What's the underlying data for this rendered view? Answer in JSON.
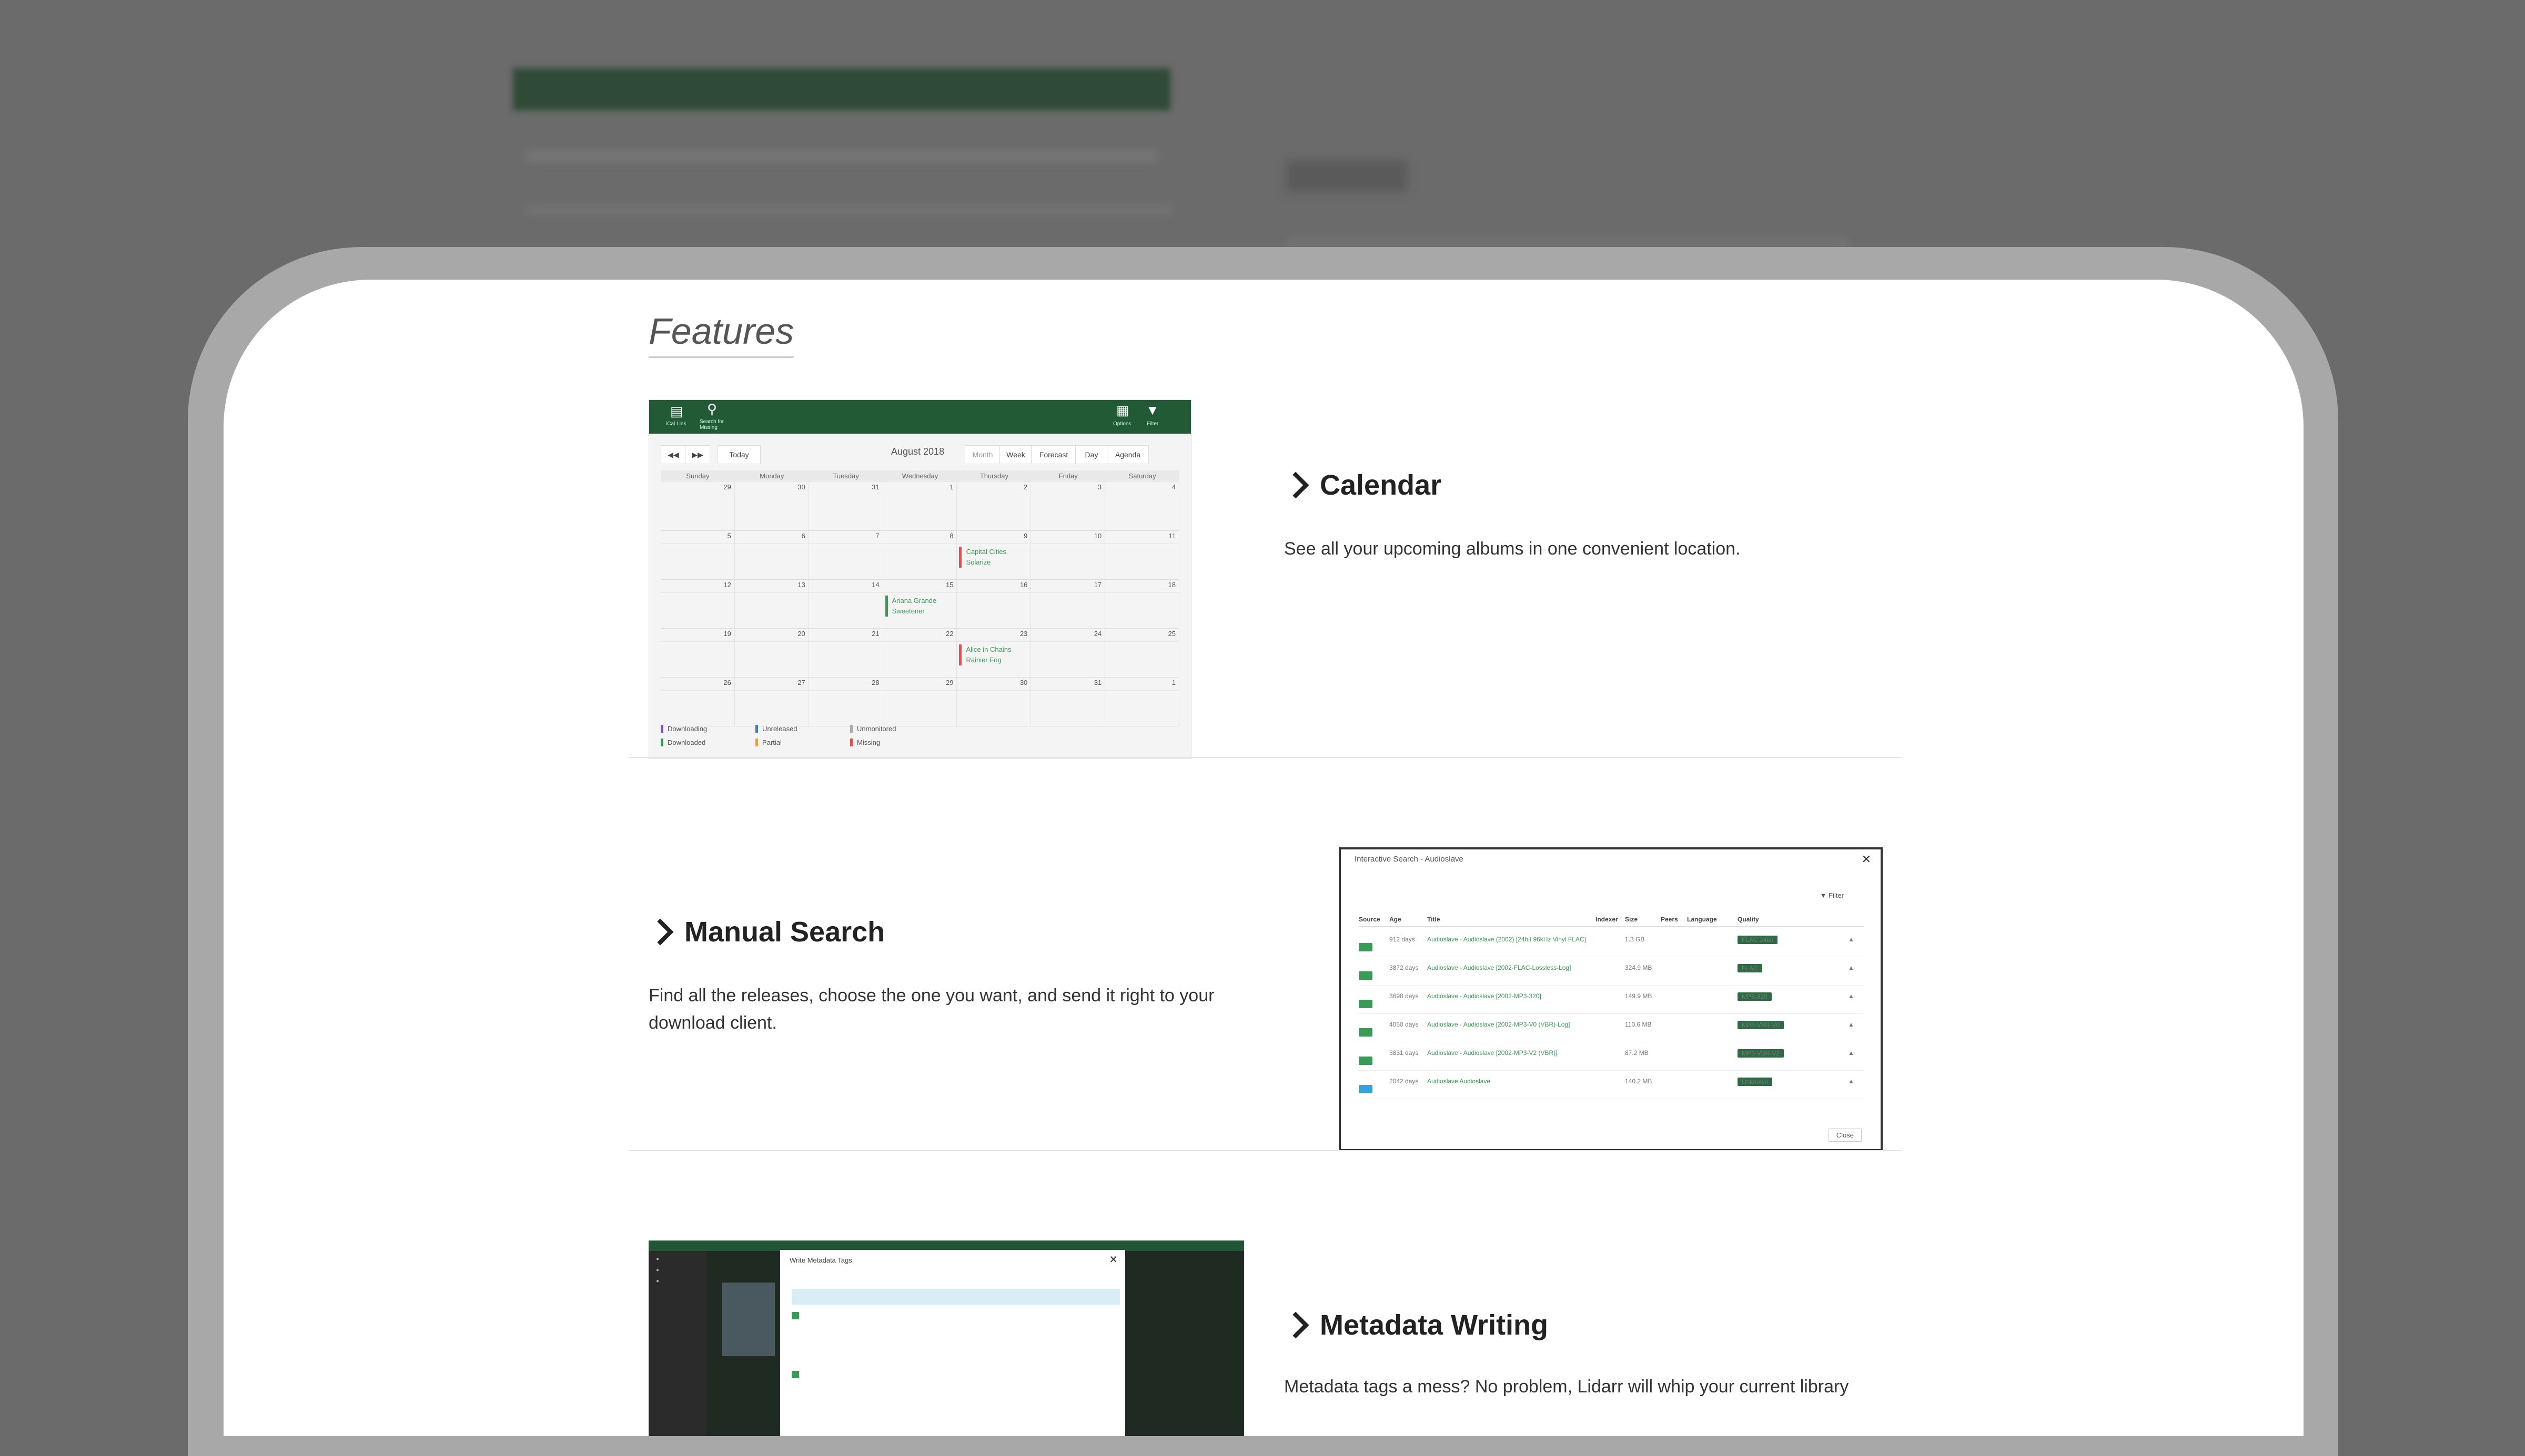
{
  "page": {
    "section_title": "Features"
  },
  "features": [
    {
      "heading": "Calendar",
      "description": "See all your upcoming albums in one convenient location."
    },
    {
      "heading": "Manual Search",
      "description": "Find all the releases, choose the one you want, and send it right to your download client."
    },
    {
      "heading": "Metadata Writing",
      "description": "Metadata tags a mess? No problem, Lidarr will whip your current library"
    }
  ],
  "calendar_screenshot": {
    "toolbar": [
      "iCal Link",
      "Search for Missing",
      "Options",
      "Filter"
    ],
    "nav": [
      "Today"
    ],
    "month": "August 2018",
    "views": [
      "Month",
      "Week",
      "Forecast",
      "Day",
      "Agenda"
    ],
    "days_of_week": [
      "Sunday",
      "Monday",
      "Tuesday",
      "Wednesday",
      "Thursday",
      "Friday",
      "Saturday"
    ],
    "weeks": [
      [
        "29",
        "30",
        "31",
        "1",
        "2",
        "3",
        "4"
      ],
      [
        "5",
        "6",
        "7",
        "8",
        "9",
        "10",
        "11"
      ],
      [
        "12",
        "13",
        "14",
        "15",
        "16",
        "17",
        "18"
      ],
      [
        "19",
        "20",
        "21",
        "22",
        "23",
        "24",
        "25"
      ],
      [
        "26",
        "27",
        "28",
        "29",
        "30",
        "31",
        "1"
      ]
    ],
    "events": [
      {
        "artist": "Capital Cities",
        "album": "Solarize",
        "color": "#e05252"
      },
      {
        "artist": "Ariana Grande",
        "album": "Sweetener",
        "color": "#3a9a57"
      },
      {
        "artist": "Alice in Chains",
        "album": "Rainier Fog",
        "color": "#e05252"
      }
    ],
    "legend": [
      {
        "label": "Downloading",
        "color": "#7a4fc0"
      },
      {
        "label": "Downloaded",
        "color": "#3a9a57"
      },
      {
        "label": "Unreleased",
        "color": "#3a7ec0"
      },
      {
        "label": "Partial",
        "color": "#f0a030"
      },
      {
        "label": "Unmonitored",
        "color": "#aaaaaa"
      },
      {
        "label": "Missing",
        "color": "#e05252"
      }
    ]
  },
  "manual_search_screenshot": {
    "title": "Interactive Search - Audioslave",
    "filter": "Filter",
    "columns": [
      "Source",
      "Age",
      "Title",
      "Indexer",
      "Size",
      "Peers",
      "Language",
      "Quality"
    ],
    "rows": [
      {
        "age": "912 days",
        "title": "Audioslave - Audioslave (2002) [24bit 96kHz Vinyl FLAC]",
        "size": "1.3 GB",
        "quality": "FLAC 24bit"
      },
      {
        "age": "3872 days",
        "title": "Audioslave - Audioslave [2002-FLAC-Lossless-Log]",
        "size": "324.9 MB",
        "quality": "FLAC"
      },
      {
        "age": "3698 days",
        "title": "Audioslave - Audioslave [2002-MP3-320]",
        "size": "149.9 MB",
        "quality": "MP3-320"
      },
      {
        "age": "4050 days",
        "title": "Audioslave - Audioslave [2002-MP3-V0 (VBR)-Log]",
        "size": "110.6 MB",
        "quality": "MP3-VBR-V0"
      },
      {
        "age": "3831 days",
        "title": "Audioslave - Audioslave [2002-MP3-V2 (VBR)]",
        "size": "87.2 MB",
        "quality": "MP3-VBR-V2"
      },
      {
        "age": "2042 days",
        "title": "Audioslave Audioslave",
        "size": "140.2 MB",
        "quality": "Unknown"
      }
    ],
    "close": "Close"
  },
  "metadata_screenshot": {
    "dialog_title": "Write Metadata Tags"
  }
}
